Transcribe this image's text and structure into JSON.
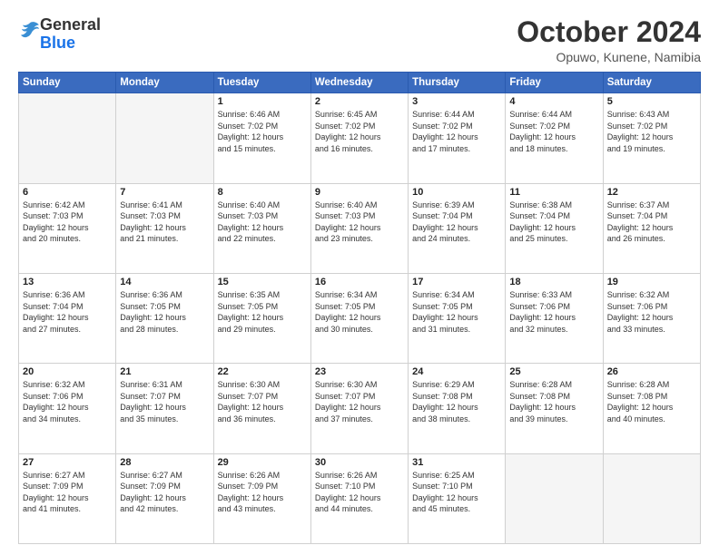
{
  "header": {
    "logo_general": "General",
    "logo_blue": "Blue",
    "month_year": "October 2024",
    "location": "Opuwo, Kunene, Namibia"
  },
  "weekdays": [
    "Sunday",
    "Monday",
    "Tuesday",
    "Wednesday",
    "Thursday",
    "Friday",
    "Saturday"
  ],
  "weeks": [
    [
      {
        "day": "",
        "info": ""
      },
      {
        "day": "",
        "info": ""
      },
      {
        "day": "1",
        "info": "Sunrise: 6:46 AM\nSunset: 7:02 PM\nDaylight: 12 hours\nand 15 minutes."
      },
      {
        "day": "2",
        "info": "Sunrise: 6:45 AM\nSunset: 7:02 PM\nDaylight: 12 hours\nand 16 minutes."
      },
      {
        "day": "3",
        "info": "Sunrise: 6:44 AM\nSunset: 7:02 PM\nDaylight: 12 hours\nand 17 minutes."
      },
      {
        "day": "4",
        "info": "Sunrise: 6:44 AM\nSunset: 7:02 PM\nDaylight: 12 hours\nand 18 minutes."
      },
      {
        "day": "5",
        "info": "Sunrise: 6:43 AM\nSunset: 7:02 PM\nDaylight: 12 hours\nand 19 minutes."
      }
    ],
    [
      {
        "day": "6",
        "info": "Sunrise: 6:42 AM\nSunset: 7:03 PM\nDaylight: 12 hours\nand 20 minutes."
      },
      {
        "day": "7",
        "info": "Sunrise: 6:41 AM\nSunset: 7:03 PM\nDaylight: 12 hours\nand 21 minutes."
      },
      {
        "day": "8",
        "info": "Sunrise: 6:40 AM\nSunset: 7:03 PM\nDaylight: 12 hours\nand 22 minutes."
      },
      {
        "day": "9",
        "info": "Sunrise: 6:40 AM\nSunset: 7:03 PM\nDaylight: 12 hours\nand 23 minutes."
      },
      {
        "day": "10",
        "info": "Sunrise: 6:39 AM\nSunset: 7:04 PM\nDaylight: 12 hours\nand 24 minutes."
      },
      {
        "day": "11",
        "info": "Sunrise: 6:38 AM\nSunset: 7:04 PM\nDaylight: 12 hours\nand 25 minutes."
      },
      {
        "day": "12",
        "info": "Sunrise: 6:37 AM\nSunset: 7:04 PM\nDaylight: 12 hours\nand 26 minutes."
      }
    ],
    [
      {
        "day": "13",
        "info": "Sunrise: 6:36 AM\nSunset: 7:04 PM\nDaylight: 12 hours\nand 27 minutes."
      },
      {
        "day": "14",
        "info": "Sunrise: 6:36 AM\nSunset: 7:05 PM\nDaylight: 12 hours\nand 28 minutes."
      },
      {
        "day": "15",
        "info": "Sunrise: 6:35 AM\nSunset: 7:05 PM\nDaylight: 12 hours\nand 29 minutes."
      },
      {
        "day": "16",
        "info": "Sunrise: 6:34 AM\nSunset: 7:05 PM\nDaylight: 12 hours\nand 30 minutes."
      },
      {
        "day": "17",
        "info": "Sunrise: 6:34 AM\nSunset: 7:05 PM\nDaylight: 12 hours\nand 31 minutes."
      },
      {
        "day": "18",
        "info": "Sunrise: 6:33 AM\nSunset: 7:06 PM\nDaylight: 12 hours\nand 32 minutes."
      },
      {
        "day": "19",
        "info": "Sunrise: 6:32 AM\nSunset: 7:06 PM\nDaylight: 12 hours\nand 33 minutes."
      }
    ],
    [
      {
        "day": "20",
        "info": "Sunrise: 6:32 AM\nSunset: 7:06 PM\nDaylight: 12 hours\nand 34 minutes."
      },
      {
        "day": "21",
        "info": "Sunrise: 6:31 AM\nSunset: 7:07 PM\nDaylight: 12 hours\nand 35 minutes."
      },
      {
        "day": "22",
        "info": "Sunrise: 6:30 AM\nSunset: 7:07 PM\nDaylight: 12 hours\nand 36 minutes."
      },
      {
        "day": "23",
        "info": "Sunrise: 6:30 AM\nSunset: 7:07 PM\nDaylight: 12 hours\nand 37 minutes."
      },
      {
        "day": "24",
        "info": "Sunrise: 6:29 AM\nSunset: 7:08 PM\nDaylight: 12 hours\nand 38 minutes."
      },
      {
        "day": "25",
        "info": "Sunrise: 6:28 AM\nSunset: 7:08 PM\nDaylight: 12 hours\nand 39 minutes."
      },
      {
        "day": "26",
        "info": "Sunrise: 6:28 AM\nSunset: 7:08 PM\nDaylight: 12 hours\nand 40 minutes."
      }
    ],
    [
      {
        "day": "27",
        "info": "Sunrise: 6:27 AM\nSunset: 7:09 PM\nDaylight: 12 hours\nand 41 minutes."
      },
      {
        "day": "28",
        "info": "Sunrise: 6:27 AM\nSunset: 7:09 PM\nDaylight: 12 hours\nand 42 minutes."
      },
      {
        "day": "29",
        "info": "Sunrise: 6:26 AM\nSunset: 7:09 PM\nDaylight: 12 hours\nand 43 minutes."
      },
      {
        "day": "30",
        "info": "Sunrise: 6:26 AM\nSunset: 7:10 PM\nDaylight: 12 hours\nand 44 minutes."
      },
      {
        "day": "31",
        "info": "Sunrise: 6:25 AM\nSunset: 7:10 PM\nDaylight: 12 hours\nand 45 minutes."
      },
      {
        "day": "",
        "info": ""
      },
      {
        "day": "",
        "info": ""
      }
    ]
  ]
}
